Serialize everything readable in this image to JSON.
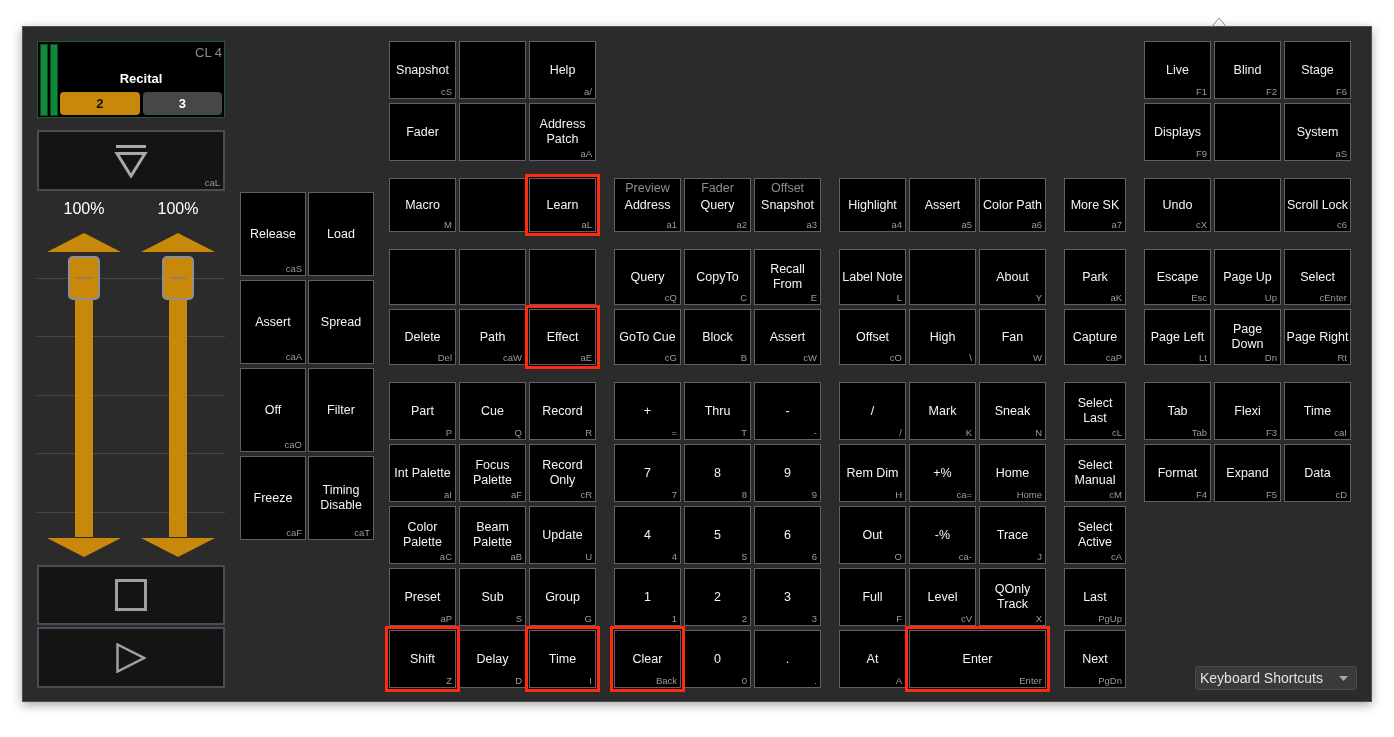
{
  "cue_list": {
    "number": "CL 4",
    "name": "Recital",
    "pages": [
      {
        "label": "2",
        "selected": true
      },
      {
        "label": "3",
        "selected": false
      }
    ]
  },
  "triangle_button": {
    "shortcut": "caL"
  },
  "faders": [
    {
      "reading": "100%",
      "level": 1
    },
    {
      "reading": "100%",
      "level": 1
    }
  ],
  "side_keys": {
    "rows": [
      [
        {
          "label": "Release",
          "shortcut": "caS",
          "highlighted": false
        },
        {
          "label": "Load",
          "highlighted": false
        }
      ],
      [
        {
          "label": "Assert",
          "shortcut": "caA",
          "highlighted": false
        },
        {
          "label": "Spread",
          "highlighted": false
        }
      ],
      [
        {
          "label": "Off",
          "shortcut": "caO",
          "highlighted": false
        },
        {
          "label": "Filter",
          "highlighted": false
        }
      ],
      [
        {
          "label": "Freeze",
          "shortcut": "caF",
          "highlighted": false
        },
        {
          "label": "Timing Disable",
          "shortcut": "caT",
          "highlighted": false
        }
      ]
    ]
  },
  "key_blocks": [
    {
      "sections": [
        {
          "rows": [
            [
              {
                "label": "Snapshot",
                "shortcut": "cS",
                "highlighted": false
              },
              {
                "highlighted": false
              },
              {
                "label": "Help",
                "shortcut": "a/",
                "highlighted": false
              }
            ],
            [
              {
                "label": "Fader",
                "highlighted": false
              },
              {
                "highlighted": false
              },
              {
                "label": "Address Patch",
                "shortcut": "aA",
                "highlighted": false
              }
            ]
          ]
        },
        {
          "rows": [
            [
              {
                "label": "Macro",
                "shortcut": "M",
                "highlighted": false
              },
              {
                "highlighted": false
              },
              {
                "label": "Learn",
                "shortcut": "aL",
                "highlighted": true
              }
            ]
          ]
        },
        {
          "rows": [
            [
              {
                "highlighted": false
              },
              {
                "highlighted": false
              },
              {
                "highlighted": false
              }
            ],
            [
              {
                "label": "Delete",
                "shortcut": "Del",
                "highlighted": false
              },
              {
                "label": "Path",
                "shortcut": "caW",
                "highlighted": false
              },
              {
                "label": "Effect",
                "shortcut": "aE",
                "highlighted": true
              }
            ]
          ]
        },
        {
          "rows": [
            [
              {
                "label": "Part",
                "shortcut": "P",
                "highlighted": false
              },
              {
                "label": "Cue",
                "shortcut": "Q",
                "highlighted": false
              },
              {
                "label": "Record",
                "shortcut": "R",
                "highlighted": false
              }
            ],
            [
              {
                "label": "Int Palette",
                "shortcut": "aI",
                "highlighted": false
              },
              {
                "label": "Focus Palette",
                "shortcut": "aF",
                "highlighted": false
              },
              {
                "label": "Record Only",
                "shortcut": "cR",
                "highlighted": false
              }
            ],
            [
              {
                "label": "Color Palette",
                "shortcut": "aC",
                "highlighted": false
              },
              {
                "label": "Beam Palette",
                "shortcut": "aB",
                "highlighted": false
              },
              {
                "label": "Update",
                "shortcut": "U",
                "highlighted": false
              }
            ],
            [
              {
                "label": "Preset",
                "shortcut": "aP",
                "highlighted": false
              },
              {
                "label": "Sub",
                "shortcut": "S",
                "highlighted": false
              },
              {
                "label": "Group",
                "shortcut": "G",
                "highlighted": false
              }
            ],
            [
              {
                "label": "Shift",
                "shortcut": "Z",
                "highlighted": true
              },
              {
                "label": "Delay",
                "shortcut": "D",
                "highlighted": false
              },
              {
                "label": "Time",
                "shortcut": "I",
                "highlighted": true
              }
            ]
          ]
        }
      ]
    },
    {
      "sections": [
        {
          "rows": [
            [
              {
                "alt_label": "Preview",
                "label": "Address",
                "shortcut": "a1",
                "highlighted": false
              },
              {
                "alt_label": "Fader",
                "label": "Query",
                "shortcut": "a2",
                "highlighted": false
              },
              {
                "alt_label": "Offset",
                "label": "Snapshot",
                "shortcut": "a3",
                "highlighted": false
              }
            ]
          ]
        },
        {
          "rows": [
            [
              {
                "label": "Query",
                "shortcut": "cQ",
                "highlighted": false
              },
              {
                "label": "CopyTo",
                "shortcut": "C",
                "highlighted": false
              },
              {
                "label": "Recall From",
                "shortcut": "E",
                "highlighted": false
              }
            ],
            [
              {
                "label": "GoTo Cue",
                "shortcut": "cG",
                "highlighted": false
              },
              {
                "label": "Block",
                "shortcut": "B",
                "highlighted": false
              },
              {
                "label": "Assert",
                "shortcut": "cW",
                "highlighted": false
              }
            ]
          ]
        },
        {
          "rows": [
            [
              {
                "label": "+",
                "shortcut": "=",
                "highlighted": false
              },
              {
                "label": "Thru",
                "shortcut": "T",
                "highlighted": false
              },
              {
                "label": "-",
                "shortcut": "-",
                "highlighted": false
              }
            ],
            [
              {
                "label": "7",
                "shortcut": "7",
                "highlighted": false
              },
              {
                "label": "8",
                "shortcut": "8",
                "highlighted": false
              },
              {
                "label": "9",
                "shortcut": "9",
                "highlighted": false
              }
            ],
            [
              {
                "label": "4",
                "shortcut": "4",
                "highlighted": false
              },
              {
                "label": "5",
                "shortcut": "5",
                "highlighted": false
              },
              {
                "label": "6",
                "shortcut": "6",
                "highlighted": false
              }
            ],
            [
              {
                "label": "1",
                "shortcut": "1",
                "highlighted": false
              },
              {
                "label": "2",
                "shortcut": "2",
                "highlighted": false
              },
              {
                "label": "3",
                "shortcut": "3",
                "highlighted": false
              }
            ],
            [
              {
                "label": "Clear",
                "shortcut": "Back",
                "highlighted": true
              },
              {
                "label": "0",
                "shortcut": "0",
                "highlighted": false
              },
              {
                "label": ".",
                "shortcut": ".",
                "highlighted": false
              }
            ]
          ]
        }
      ]
    },
    {
      "sections": [
        {
          "rows": [
            [
              {
                "label": "Highlight",
                "shortcut": "a4",
                "highlighted": false
              },
              {
                "label": "Assert",
                "shortcut": "a5",
                "highlighted": false
              },
              {
                "label": "Color Path",
                "shortcut": "a6",
                "highlighted": false
              }
            ]
          ]
        },
        {
          "rows": [
            [
              {
                "label": "Label Note",
                "shortcut": "L",
                "highlighted": false
              },
              {
                "highlighted": false
              },
              {
                "label": "About",
                "shortcut": "Y",
                "highlighted": false
              }
            ],
            [
              {
                "label": "Offset",
                "shortcut": "cO",
                "highlighted": false
              },
              {
                "label": "High",
                "shortcut": "\\",
                "highlighted": false
              },
              {
                "label": "Fan",
                "shortcut": "W",
                "highlighted": false
              }
            ]
          ]
        },
        {
          "rows": [
            [
              {
                "label": "/",
                "shortcut": "/",
                "highlighted": false
              },
              {
                "label": "Mark",
                "shortcut": "K",
                "highlighted": false
              },
              {
                "label": "Sneak",
                "shortcut": "N",
                "highlighted": false
              }
            ],
            [
              {
                "label": "Rem Dim",
                "shortcut": "H",
                "highlighted": false
              },
              {
                "label": "+%",
                "shortcut": "ca=",
                "highlighted": false
              },
              {
                "label": "Home",
                "shortcut": "Home",
                "highlighted": false
              }
            ],
            [
              {
                "label": "Out",
                "shortcut": "O",
                "highlighted": false
              },
              {
                "label": "-%",
                "shortcut": "ca-",
                "highlighted": false
              },
              {
                "label": "Trace",
                "shortcut": "J",
                "highlighted": false
              }
            ],
            [
              {
                "label": "Full",
                "shortcut": "F",
                "highlighted": false
              },
              {
                "label": "Level",
                "shortcut": "cV",
                "highlighted": false
              },
              {
                "label": "QOnly Track",
                "shortcut": "X",
                "highlighted": false
              }
            ],
            [
              {
                "label": "At",
                "shortcut": "A",
                "highlighted": false
              },
              {
                "label": "Enter",
                "shortcut": "Enter",
                "highlighted": true
              }
            ]
          ]
        }
      ]
    },
    {
      "sections": [
        {
          "rows": [
            [
              {
                "label": "More SK",
                "shortcut": "a7",
                "highlighted": false
              }
            ]
          ]
        },
        {
          "rows": [
            [
              {
                "label": "Park",
                "shortcut": "aK",
                "highlighted": false
              }
            ],
            [
              {
                "label": "Capture",
                "shortcut": "caP",
                "highlighted": false
              }
            ]
          ]
        },
        {
          "rows": [
            [
              {
                "label": "Select Last",
                "shortcut": "cL",
                "highlighted": false
              }
            ],
            [
              {
                "label": "Select Manual",
                "shortcut": "cM",
                "highlighted": false
              }
            ],
            [
              {
                "label": "Select Active",
                "shortcut": "cA",
                "highlighted": false
              }
            ],
            [
              {
                "label": "Last",
                "shortcut": "PgUp",
                "highlighted": false
              }
            ],
            [
              {
                "label": "Next",
                "shortcut": "PgDn",
                "highlighted": false
              }
            ]
          ]
        }
      ]
    },
    {
      "sections": [
        {
          "rows": [
            [
              {
                "label": "Live",
                "shortcut": "F1",
                "highlighted": false
              },
              {
                "label": "Blind",
                "shortcut": "F2",
                "highlighted": false
              },
              {
                "label": "Stage",
                "shortcut": "F6",
                "highlighted": false
              }
            ],
            [
              {
                "label": "Displays",
                "shortcut": "F9",
                "highlighted": false
              },
              {
                "highlighted": false
              },
              {
                "label": "System",
                "shortcut": "aS",
                "highlighted": false
              }
            ]
          ]
        },
        {
          "rows": [
            [
              {
                "label": "Undo",
                "shortcut": "cX",
                "highlighted": false
              },
              {
                "highlighted": false
              },
              {
                "label": "Scroll Lock",
                "shortcut": "c6",
                "highlighted": false
              }
            ]
          ]
        },
        {
          "rows": [
            [
              {
                "label": "Escape",
                "shortcut": "Esc",
                "highlighted": false
              },
              {
                "label": "Page Up",
                "shortcut": "Up",
                "highlighted": false
              },
              {
                "label": "Select",
                "shortcut": "cEnter",
                "highlighted": false
              }
            ],
            [
              {
                "label": "Page Left",
                "shortcut": "Lt",
                "highlighted": false
              },
              {
                "label": "Page Down",
                "shortcut": "Dn",
                "highlighted": false
              },
              {
                "label": "Page Right",
                "shortcut": "Rt",
                "highlighted": false
              }
            ]
          ]
        },
        {
          "rows": [
            [
              {
                "label": "Tab",
                "shortcut": "Tab",
                "highlighted": false
              },
              {
                "label": "Flexi",
                "shortcut": "F3",
                "highlighted": false
              },
              {
                "label": "Time",
                "shortcut": "caI",
                "highlighted": false
              }
            ],
            [
              {
                "label": "Format",
                "shortcut": "F4",
                "highlighted": false
              },
              {
                "label": "Expand",
                "shortcut": "F5",
                "highlighted": false
              },
              {
                "label": "Data",
                "shortcut": "cD",
                "highlighted": false
              }
            ]
          ]
        }
      ]
    }
  ],
  "mode_menu": {
    "value": "Keyboard Shortcuts"
  }
}
